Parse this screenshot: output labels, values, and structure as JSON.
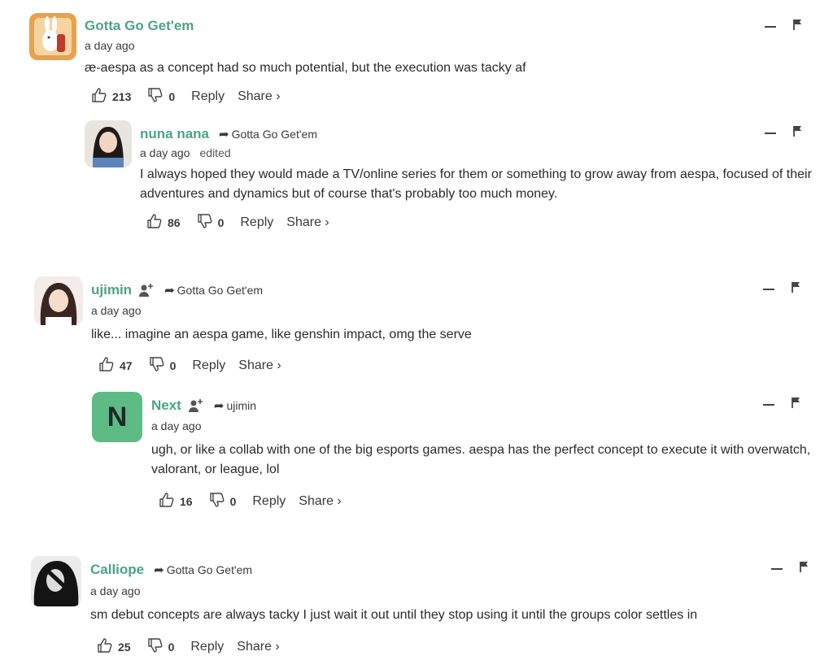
{
  "comments": [
    {
      "author": "Gotta Go Get'em",
      "reply_to": "",
      "time": "a day ago",
      "edited": "",
      "text": "æ-aespa as a concept had so much potential, but the execution was tacky af",
      "likes": "213",
      "dislikes": "0",
      "reply_label": "Reply",
      "share_label": "Share ›"
    },
    {
      "author": "nuna nana",
      "reply_to": "Gotta Go Get'em",
      "time": "a day ago",
      "edited": "edited",
      "text": "I always hoped they would made a TV/online series for them or something to grow away from aespa, focused of their adventures and dynamics but of course that's probably too much money.",
      "likes": "86",
      "dislikes": "0",
      "reply_label": "Reply",
      "share_label": "Share ›"
    },
    {
      "author": "ujimin",
      "reply_to": "Gotta Go Get'em",
      "time": "a day ago",
      "edited": "",
      "text": "like... imagine an aespa game, like genshin impact, omg the serve",
      "likes": "47",
      "dislikes": "0",
      "reply_label": "Reply",
      "share_label": "Share ›"
    },
    {
      "author": "Next",
      "avatar_letter": "N",
      "avatar_color": "#5fbb86",
      "reply_to": "ujimin",
      "time": "a day ago",
      "edited": "",
      "text": "ugh, or like a collab with one of the big esports games. aespa has the perfect concept to execute it with overwatch, valorant, or league, lol",
      "likes": "16",
      "dislikes": "0",
      "reply_label": "Reply",
      "share_label": "Share ›"
    },
    {
      "author": "Calliope",
      "reply_to": "Gotta Go Get'em",
      "time": "a day ago",
      "edited": "",
      "text": "sm debut concepts are always tacky I just wait it out until they stop using it until the groups color settles in",
      "likes": "25",
      "dislikes": "0",
      "reply_label": "Reply",
      "share_label": "Share ›"
    }
  ],
  "colors": {
    "author": "#4aa583",
    "text": "#2a2a2a"
  }
}
